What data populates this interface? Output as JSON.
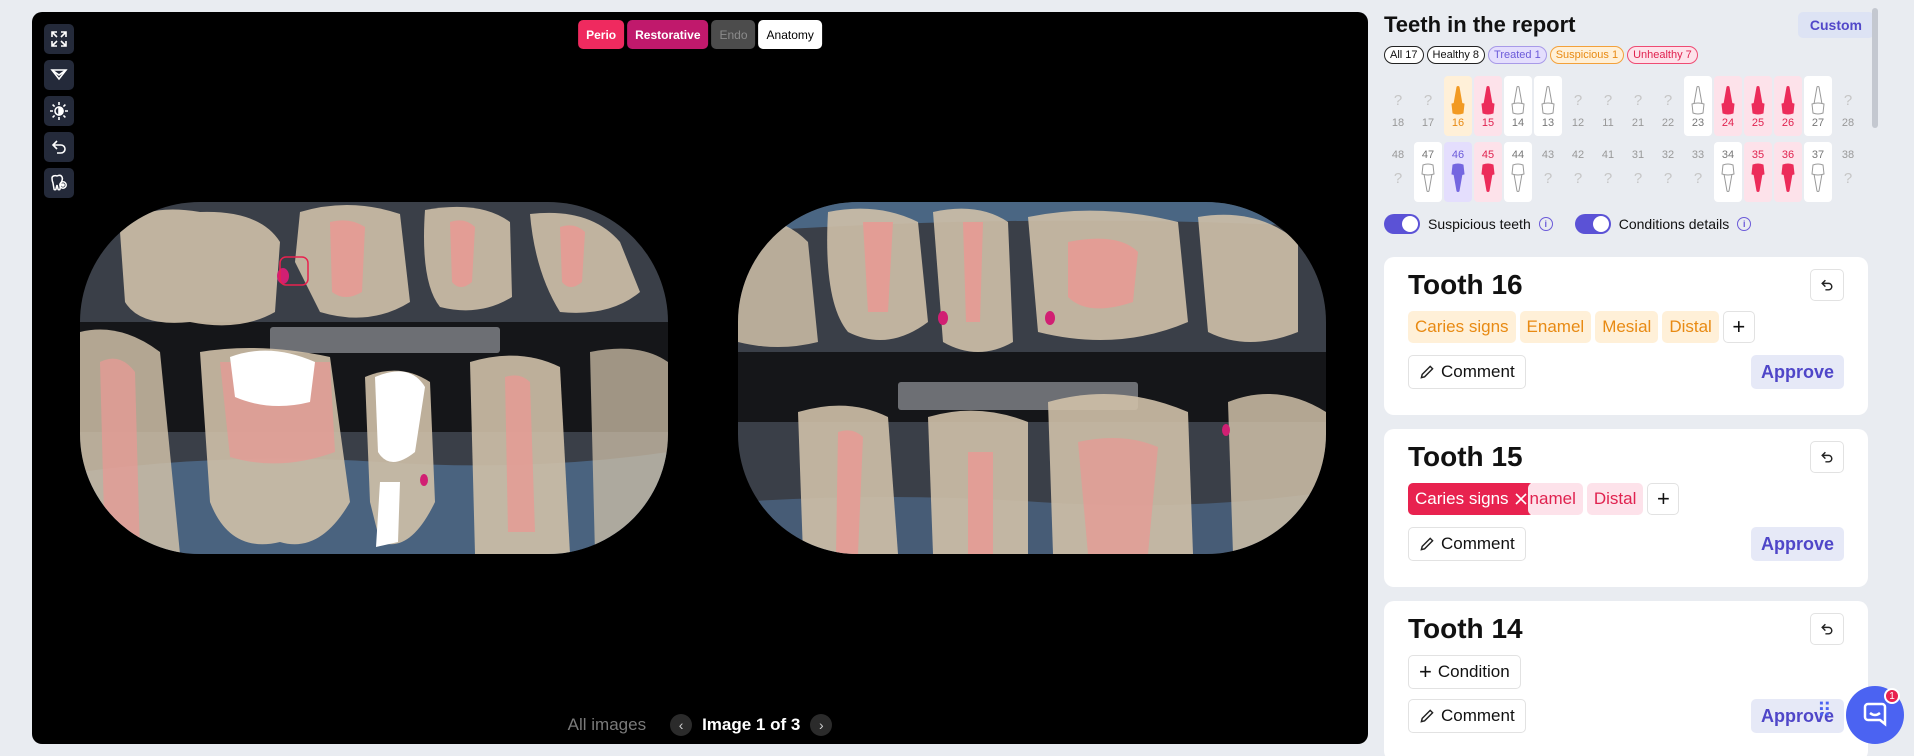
{
  "viewer": {
    "layers": [
      "Perio",
      "Restorative",
      "Endo",
      "Anatomy"
    ],
    "tool_icons": [
      "expand-icon",
      "filter-icon",
      "brightness-icon",
      "undo-icon",
      "tooth-view-icon"
    ],
    "all_images_label": "All images",
    "page_label": "Image 1 of 3"
  },
  "panel": {
    "title": "Teeth in the report",
    "custom_label": "Custom",
    "filters": [
      {
        "label": "All 17",
        "kind": "all"
      },
      {
        "label": "Healthy 8",
        "kind": "healthy"
      },
      {
        "label": "Treated 1",
        "kind": "treated"
      },
      {
        "label": "Suspicious 1",
        "kind": "suspicious"
      },
      {
        "label": "Unhealthy 7",
        "kind": "unhealthy"
      }
    ],
    "upper_teeth": [
      {
        "num": "18",
        "state": "missing"
      },
      {
        "num": "17",
        "state": "missing"
      },
      {
        "num": "16",
        "state": "suspicious"
      },
      {
        "num": "15",
        "state": "unhealthy"
      },
      {
        "num": "14",
        "state": "present"
      },
      {
        "num": "13",
        "state": "present"
      },
      {
        "num": "12",
        "state": "missing"
      },
      {
        "num": "11",
        "state": "missing"
      },
      {
        "num": "21",
        "state": "missing"
      },
      {
        "num": "22",
        "state": "missing"
      },
      {
        "num": "23",
        "state": "present"
      },
      {
        "num": "24",
        "state": "unhealthy"
      },
      {
        "num": "25",
        "state": "unhealthy"
      },
      {
        "num": "26",
        "state": "unhealthy"
      },
      {
        "num": "27",
        "state": "present"
      },
      {
        "num": "28",
        "state": "missing"
      }
    ],
    "lower_teeth": [
      {
        "num": "48",
        "state": "missing"
      },
      {
        "num": "47",
        "state": "present"
      },
      {
        "num": "46",
        "state": "treated"
      },
      {
        "num": "45",
        "state": "unhealthy"
      },
      {
        "num": "44",
        "state": "present"
      },
      {
        "num": "43",
        "state": "missing"
      },
      {
        "num": "42",
        "state": "missing"
      },
      {
        "num": "41",
        "state": "missing"
      },
      {
        "num": "31",
        "state": "missing"
      },
      {
        "num": "32",
        "state": "missing"
      },
      {
        "num": "33",
        "state": "missing"
      },
      {
        "num": "34",
        "state": "present"
      },
      {
        "num": "35",
        "state": "unhealthy"
      },
      {
        "num": "36",
        "state": "unhealthy"
      },
      {
        "num": "37",
        "state": "present"
      },
      {
        "num": "38",
        "state": "missing"
      }
    ],
    "missing_glyph": "?",
    "toggles": [
      {
        "label": "Suspicious teeth",
        "on": true
      },
      {
        "label": "Conditions details",
        "on": true
      }
    ],
    "info_glyph": "i",
    "comment_label": "Comment",
    "approve_label": "Approve",
    "condition_label": "Condition",
    "cards": [
      {
        "title": "Tooth 16",
        "tags": [
          "Caries signs",
          "Enamel",
          "Mesial",
          "Distal"
        ]
      },
      {
        "title": "Tooth 15",
        "selected_tag": "Caries signs",
        "tags": [
          "namel",
          "Distal"
        ]
      },
      {
        "title": "Tooth 14",
        "tags": []
      }
    ],
    "chat_badge": "1"
  },
  "colors": {
    "accent": "#5b52d6",
    "unhealthy": "#e0224f",
    "suspicious": "#e88a13",
    "treated": "#6b5ad9"
  }
}
